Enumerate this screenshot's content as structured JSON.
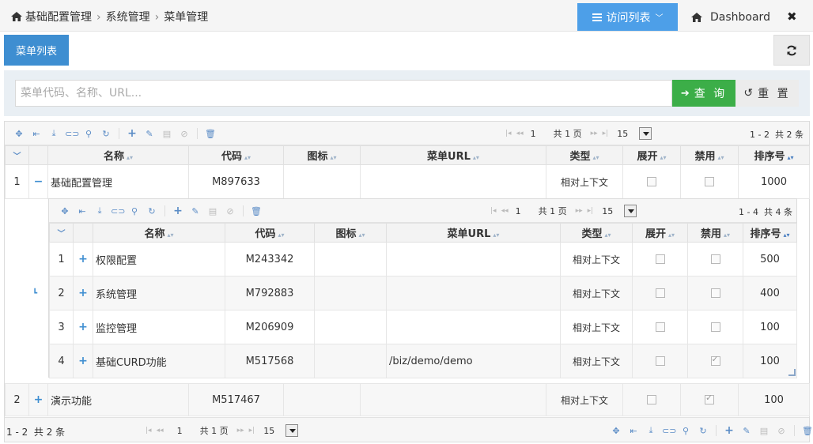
{
  "breadcrumb": {
    "root": "基础配置管理",
    "level2": "系统管理",
    "level3": "菜单管理"
  },
  "header": {
    "visit_label": "访问列表",
    "dashboard_label": "Dashboard",
    "close_label": "✖"
  },
  "tab": {
    "label": "菜单列表"
  },
  "search": {
    "placeholder": "菜单代码、名称、URL...",
    "query_label": "查 询",
    "reset_label": "重 置"
  },
  "columns": [
    "名称",
    "代码",
    "图标",
    "菜单URL",
    "类型",
    "展开",
    "禁用",
    "排序号"
  ],
  "outer_pager": {
    "page": "1",
    "total_pages": "共 1 页",
    "page_size": "15",
    "range": "1 - 2",
    "total": "共 2 条"
  },
  "inner_pager": {
    "page": "1",
    "total_pages": "共 1 页",
    "page_size": "15",
    "range": "1 - 4",
    "total": "共 4 条"
  },
  "rows": [
    {
      "index": "1",
      "expander": "−",
      "name": "基础配置管理",
      "code": "M897633",
      "icon": "",
      "url": "",
      "type": "相对上下文",
      "expand": false,
      "disabled": false,
      "order": "1000"
    },
    {
      "index": "2",
      "expander": "+",
      "name": "演示功能",
      "code": "M517467",
      "icon": "",
      "url": "",
      "type": "相对上下文",
      "expand": false,
      "disabled": true,
      "order": "100"
    }
  ],
  "child_rows": [
    {
      "index": "1",
      "expander": "+",
      "name": "权限配置",
      "code": "M243342",
      "icon": "",
      "url": "",
      "type": "相对上下文",
      "expand": false,
      "disabled": false,
      "order": "500"
    },
    {
      "index": "2",
      "expander": "+",
      "name": "系统管理",
      "code": "M792883",
      "icon": "",
      "url": "",
      "type": "相对上下文",
      "expand": false,
      "disabled": false,
      "order": "400"
    },
    {
      "index": "3",
      "expander": "+",
      "name": "监控管理",
      "code": "M206909",
      "icon": "",
      "url": "",
      "type": "相对上下文",
      "expand": false,
      "disabled": false,
      "order": "100"
    },
    {
      "index": "4",
      "expander": "+",
      "name": "基础CURD功能",
      "code": "M517568",
      "icon": "",
      "url": "/biz/demo/demo",
      "type": "相对上下文",
      "expand": false,
      "disabled": true,
      "order": "100"
    }
  ]
}
